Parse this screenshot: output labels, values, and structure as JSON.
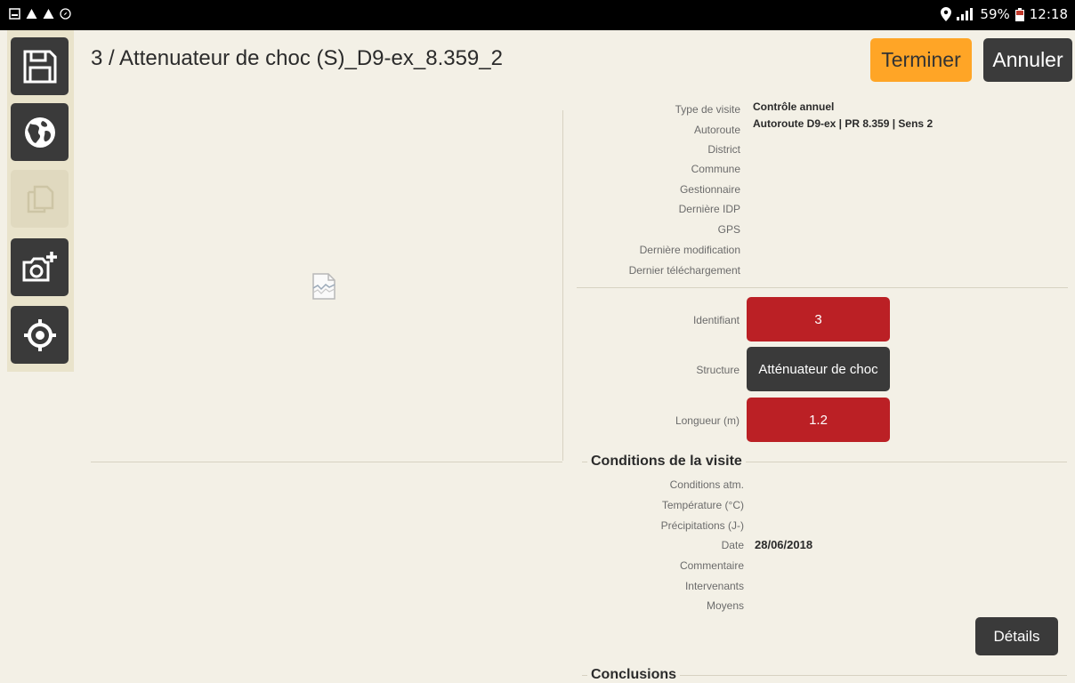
{
  "status_bar": {
    "battery": "59%",
    "time": "12:18"
  },
  "sidebar": {
    "items": [
      {
        "icon": "save-icon"
      },
      {
        "icon": "globe-icon"
      },
      {
        "icon": "copy-icon"
      },
      {
        "icon": "camera-add-icon"
      },
      {
        "icon": "locate-icon"
      }
    ]
  },
  "header": {
    "title": "3 / Attenuateur de choc (S)_D9-ex_8.359_2",
    "terminer_label": "Terminer",
    "annuler_label": "Annuler"
  },
  "info": {
    "rows": [
      {
        "label": "Type de visite",
        "value": "Contrôle annuel"
      },
      {
        "label": "Autoroute",
        "value": "Autoroute D9-ex | PR 8.359 | Sens 2"
      },
      {
        "label": "District",
        "value": ""
      },
      {
        "label": "Commune",
        "value": ""
      },
      {
        "label": "Gestionnaire",
        "value": ""
      },
      {
        "label": "Dernière IDP",
        "value": ""
      },
      {
        "label": "GPS",
        "value": ""
      },
      {
        "label": "Dernière modification",
        "value": ""
      },
      {
        "label": "Dernier téléchargement",
        "value": ""
      }
    ]
  },
  "fields": {
    "identifiant": {
      "label": "Identifiant",
      "value": "3"
    },
    "structure": {
      "label": "Structure",
      "value": "Atténuateur de choc"
    },
    "longueur": {
      "label": "Longueur (m)",
      "value": "1.2"
    }
  },
  "conditions": {
    "title": "Conditions de la visite",
    "rows": [
      {
        "label": "Conditions atm.",
        "value": ""
      },
      {
        "label": "Température (°C)",
        "value": ""
      },
      {
        "label": "Précipitations (J-)",
        "value": ""
      },
      {
        "label": "Date",
        "value": "28/06/2018"
      },
      {
        "label": "Commentaire",
        "value": ""
      },
      {
        "label": "Intervenants",
        "value": ""
      },
      {
        "label": "Moyens",
        "value": ""
      }
    ],
    "details_label": "Détails"
  },
  "conclusions": {
    "title": "Conclusions"
  },
  "colors": {
    "background": "#f3f0e6",
    "accent_orange": "#ffa526",
    "red_field": "#bb2025",
    "dark_button": "#3a3a3a"
  }
}
